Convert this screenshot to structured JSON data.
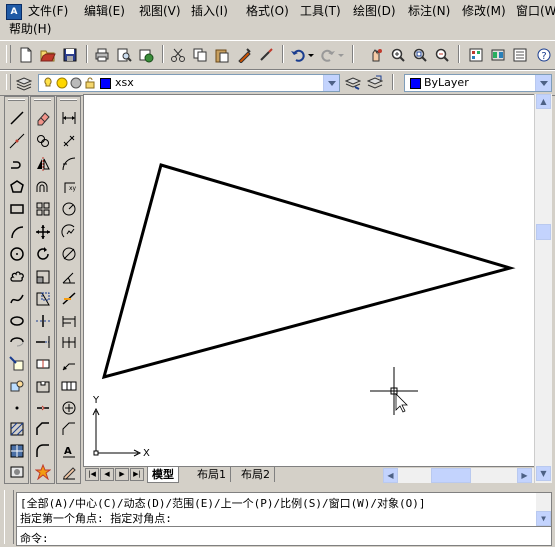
{
  "menu": {
    "items": [
      "文件(F)",
      "编辑(E)",
      "视图(V)",
      "插入(I)",
      "格式(O)",
      "工具(T)",
      "绘图(D)",
      "标注(N)",
      "修改(M)",
      "窗口(W)",
      "帮助(H)"
    ]
  },
  "layer_toolbar": {
    "layer_name": "xsx",
    "color_value": "ByLayer"
  },
  "canvas": {
    "ucs_x_label": "X",
    "ucs_y_label": "Y"
  },
  "tabs": [
    "模型",
    "布局1",
    "布局2"
  ],
  "command": {
    "history_line_1": "[全部(A)/中心(C)/动态(D)/范围(E)/上一个(P)/比例(S)/窗口(W)/对象(O)]",
    "history_line_2": "指定第一个角点: 指定对角点:",
    "prompt": "命令:"
  },
  "colors": {
    "chrome": "#d4d0c8",
    "combo_arrow": "#c3d3fd",
    "layer_swatch": "#0000ff",
    "drawing_line": "#000000"
  },
  "icons": {
    "standard_toolbar": [
      "new-icon",
      "open-icon",
      "save-icon",
      "print-icon",
      "print-preview-icon",
      "publish-icon",
      "cut-icon",
      "copy-icon",
      "paste-icon",
      "match-properties-icon",
      "block-editor-icon",
      "undo-icon",
      "redo-icon",
      "pan-icon",
      "zoom-realtime-icon",
      "zoom-window-icon",
      "zoom-previous-icon",
      "properties-icon",
      "design-center-icon",
      "tool-palettes-icon"
    ],
    "draw_toolbar": [
      "line-icon",
      "construction-line-icon",
      "polyline-icon",
      "polygon-icon",
      "rectangle-icon",
      "arc-icon",
      "circle-icon",
      "revision-cloud-icon",
      "spline-icon",
      "ellipse-icon",
      "ellipse-arc-icon",
      "insert-block-icon",
      "make-block-icon",
      "point-icon",
      "hatch-icon",
      "gradient-icon",
      "region-icon",
      "table-icon",
      "multiline-text-icon"
    ],
    "modify_toolbar": [
      "erase-icon",
      "copy-object-icon",
      "mirror-icon",
      "offset-icon",
      "array-icon",
      "move-icon",
      "rotate-icon",
      "scale-icon",
      "stretch-icon",
      "trim-icon",
      "extend-icon",
      "break-at-point-icon",
      "break-icon",
      "join-icon",
      "chamfer-icon",
      "fillet-icon",
      "explode-icon"
    ],
    "dimension_toolbar": [
      "linear-dim-icon",
      "aligned-dim-icon",
      "arc-length-icon",
      "ordinate-icon",
      "radius-icon",
      "jogged-icon",
      "diameter-icon",
      "angular-icon",
      "quick-dim-icon",
      "baseline-icon",
      "continue-icon",
      "quick-leader-icon",
      "tolerance-icon",
      "center-mark-icon",
      "dim-edit-icon",
      "dim-text-edit-icon",
      "dim-update-icon",
      "dim-style-icon"
    ]
  }
}
